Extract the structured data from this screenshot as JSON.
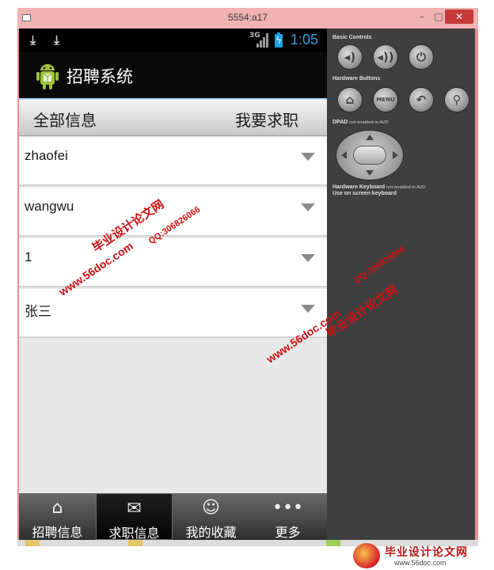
{
  "window": {
    "title": "5554:a17",
    "minimize_glyph": "–",
    "maximize_glyph": "□",
    "close_glyph": "✕"
  },
  "statusbar": {
    "network": "3G",
    "time": "1:05",
    "download_glyph": "⤓"
  },
  "appbar": {
    "title": "招聘系统",
    "logo_icon": "android-robot-icon"
  },
  "tabs": {
    "all": "全部信息",
    "job": "我要求职"
  },
  "list": {
    "items": [
      "zhaofei",
      "wangwu",
      "1",
      "张三"
    ]
  },
  "tabbar": {
    "items": [
      {
        "label": "招聘信息",
        "icon": "home-icon",
        "glyph": "⌂",
        "active": false
      },
      {
        "label": "求职信息",
        "icon": "mail-icon",
        "glyph": "✉",
        "active": true
      },
      {
        "label": "我的收藏",
        "icon": "person-icon",
        "glyph": "☺",
        "active": false
      },
      {
        "label": "更多",
        "icon": "more-icon",
        "glyph": "•••",
        "active": false
      }
    ]
  },
  "controls": {
    "basic_title": "Basic Controls",
    "hardware_title": "Hardware Buttons",
    "dpad_title": "DPAD",
    "dpad_note": "not enabled in AVD",
    "keyboard_title": "Hardware Keyboard",
    "keyboard_note": "not enabled in AVD",
    "keyboard_line2": "Use on screen keyboard",
    "menu_label": "MENU",
    "vol_down_glyph": "◂)",
    "vol_up_glyph": "◂))",
    "power_glyph": "⏻",
    "home_glyph": "⌂",
    "back_glyph": "↶",
    "search_glyph": "⚲"
  },
  "watermarks": {
    "site_cn": "毕业设计论文网",
    "site_url": "www.56doc.com",
    "qq": "QQ:306826066"
  },
  "footer_logo": {
    "cn": "毕业设计论文网",
    "url": "www.56doc.com"
  },
  "colors": {
    "phone_bg": "#e8e8e8",
    "accent_blue": "#2ea3e6",
    "watermark_red": "#cc1212",
    "window_pink": "#e98f8f"
  }
}
